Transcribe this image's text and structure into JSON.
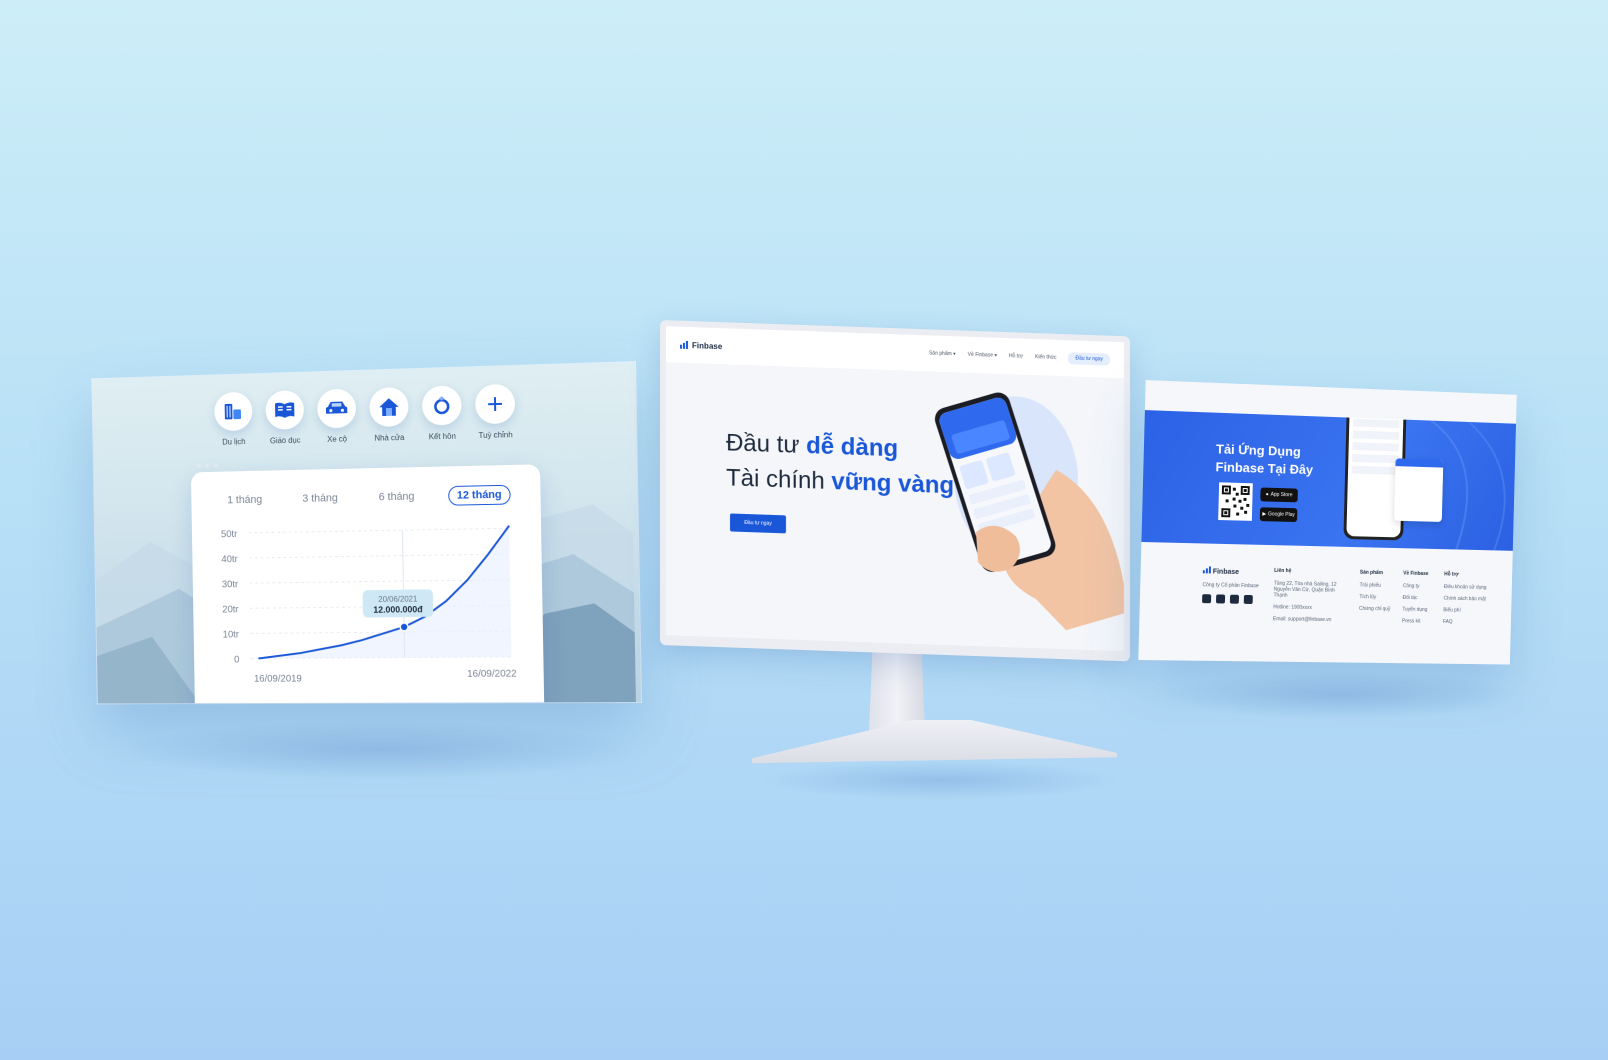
{
  "left_panel": {
    "categories": [
      {
        "label": "Du lịch",
        "icon": "luggage-icon"
      },
      {
        "label": "Giáo dục",
        "icon": "book-icon"
      },
      {
        "label": "Xe cộ",
        "icon": "car-icon"
      },
      {
        "label": "Nhà cửa",
        "icon": "house-icon"
      },
      {
        "label": "Kết hôn",
        "icon": "ring-icon"
      },
      {
        "label": "Tuỳ chỉnh",
        "icon": "plus-icon"
      }
    ],
    "tabs": [
      "1 tháng",
      "3 tháng",
      "6 tháng",
      "12 tháng"
    ],
    "active_tab": "12 tháng",
    "tooltip": {
      "date": "20/06/2021",
      "value": "12.000.000đ"
    }
  },
  "chart_data": {
    "type": "line",
    "x": [
      "16/09/2019",
      "16/09/2022"
    ],
    "y_ticks": [
      "50tr",
      "40tr",
      "30tr",
      "20tr",
      "10tr",
      "0"
    ],
    "ylim": [
      0,
      50
    ],
    "series": [
      {
        "values": [
          0,
          1,
          2,
          3.5,
          5,
          7,
          9.5,
          12,
          16,
          22,
          30,
          40,
          51
        ]
      }
    ],
    "highlight_point": {
      "x": "20/06/2021",
      "y": 12
    },
    "x_start_label": "16/09/2019",
    "x_end_label": "16/09/2022"
  },
  "monitor": {
    "brand": "Finbase",
    "nav": [
      "Sản phẩm ▾",
      "Về Finbase ▾",
      "Hỗ trợ",
      "Kiến thức"
    ],
    "nav_cta": "Đầu tư ngay",
    "hero_line1_plain": "Đầu tư ",
    "hero_line1_bold": "dễ dàng",
    "hero_line2_plain": "Tài chính ",
    "hero_line2_bold": "vững vàng",
    "hero_button": "Đầu tư ngay"
  },
  "right_panel": {
    "app_title_line1": "Tải Ứng Dụng",
    "app_title_line2": "Finbase Tại Đây",
    "app_store": "App Store",
    "google_play": "Google Play",
    "footer": {
      "brand": "Finbase",
      "company": "Công ty Cổ phần Finbase",
      "contact_head": "Liên hệ",
      "address": "Tầng 22, Tòa nhà Sailing, 12 Nguyễn Văn Cừ, Quận Bình Thạnh",
      "hotline": "Hotline: 1900xxxx",
      "email": "Email: support@finbase.vn",
      "products_head": "Sản phẩm",
      "products": [
        "Trái phiếu",
        "Tích lũy",
        "Chứng chỉ quỹ"
      ],
      "about_head": "Về Finbase",
      "about": [
        "Công ty",
        "Đối tác",
        "Tuyển dụng",
        "Press kit"
      ],
      "support_head": "Hỗ trợ",
      "support": [
        "Điều khoản sử dụng",
        "Chính sách bảo mật",
        "Biểu phí",
        "FAQ"
      ]
    }
  }
}
